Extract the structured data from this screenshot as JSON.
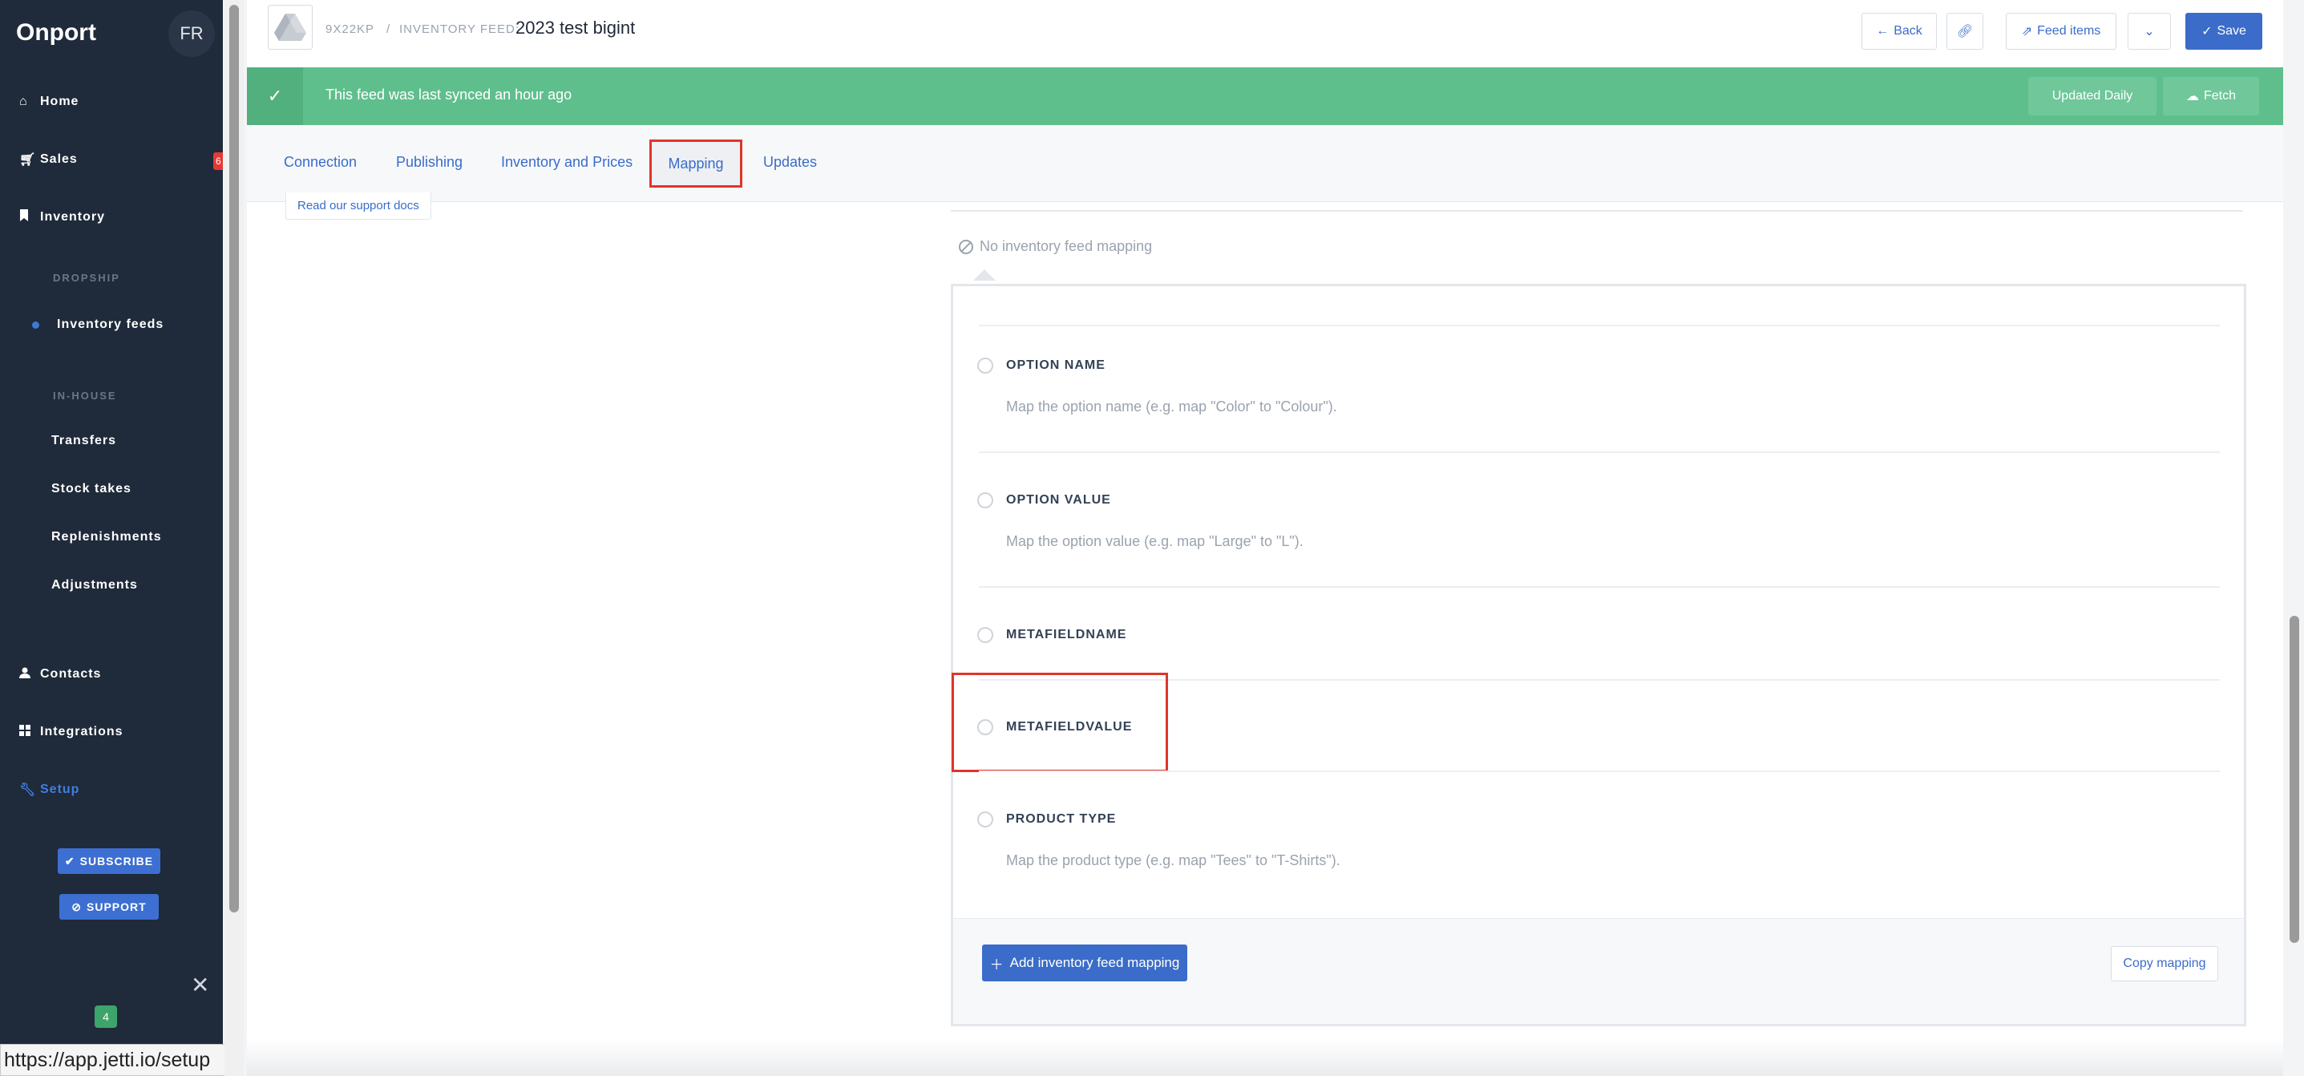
{
  "sidebar": {
    "brand": "Onport",
    "avatar": "FR",
    "items": [
      {
        "label": "Home",
        "icon": "home-icon"
      },
      {
        "label": "Sales",
        "icon": "cart-icon"
      },
      {
        "label": "Inventory",
        "icon": "bookmark-icon"
      },
      {
        "label": "Inventory feeds",
        "icon": "dot-icon"
      },
      {
        "label": "Transfers"
      },
      {
        "label": "Stock takes"
      },
      {
        "label": "Replenishments"
      },
      {
        "label": "Adjustments"
      },
      {
        "label": "Contacts",
        "icon": "user-icon"
      },
      {
        "label": "Integrations",
        "icon": "grid-icon"
      },
      {
        "label": "Setup",
        "icon": "wrench-icon"
      }
    ],
    "sections": {
      "dropship": "DROPSHIP",
      "inhouse": "IN-HOUSE"
    },
    "sales_badge": "6",
    "subscribe_label": "SUBSCRIBE",
    "support_label": "SUPPORT",
    "notification_count": "4",
    "status_url": "https://app.jetti.io/setup"
  },
  "header": {
    "feed_id": "9X22KP",
    "separator": "/",
    "feed_label": "INVENTORY FEED:",
    "feed_name": "2023 test bigint",
    "back_label": "Back",
    "feed_items_label": "Feed items",
    "save_label": "Save"
  },
  "sync": {
    "message": "This feed was last synced an hour ago",
    "updated_label": "Updated Daily",
    "fetch_label": "Fetch"
  },
  "tabs": [
    "Connection",
    "Publishing",
    "Inventory and Prices",
    "Mapping",
    "Updates"
  ],
  "active_tab": "Mapping",
  "support_docs": "Read our support docs",
  "mapping": {
    "empty_text": "No inventory feed mapping",
    "options": [
      {
        "label": "OPTION NAME",
        "desc": "Map the option name (e.g. map \"Color\" to \"Colour\")."
      },
      {
        "label": "OPTION VALUE",
        "desc": "Map the option value (e.g. map \"Large\" to \"L\")."
      },
      {
        "label": "METAFIELDNAME",
        "desc": ""
      },
      {
        "label": "METAFIELDVALUE",
        "desc": ""
      },
      {
        "label": "PRODUCT TYPE",
        "desc": "Map the product type (e.g. map \"Tees\" to \"T-Shirts\")."
      }
    ],
    "add_label": "Add inventory feed mapping",
    "copy_label": "Copy mapping"
  },
  "colors": {
    "sidebar_bg": "#1f2a3a",
    "accent": "#3b6cc9",
    "success": "#5fbf8c",
    "highlight": "#e0352b"
  }
}
